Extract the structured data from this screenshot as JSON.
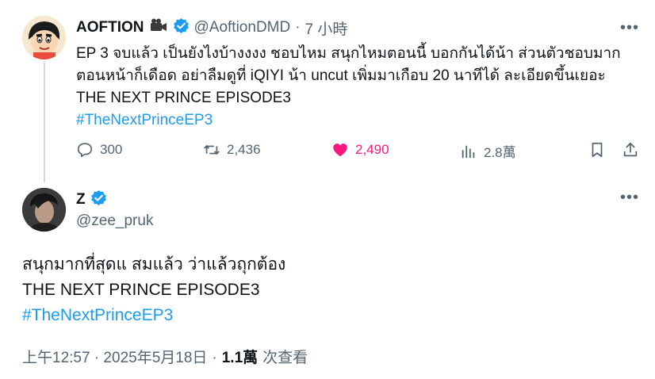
{
  "tweet": {
    "author_name": "AOFTION",
    "author_handle": "@AoftionDMD",
    "separator": "·",
    "time": "7 小時",
    "lines": [
      "EP 3 จบแล้ว เป็นยังไงบ้างงงง ชอบไหม สนุกไหมตอนนี้ บอกกันได้น้า ส่วนตัวชอบมาก",
      "ตอนหน้าก็เดือด อย่าลืมดูที่ iQIYI น้า uncut เพิ่มมาเกือบ 20 นาทีได้ ละเอียดขึ้นเยอะ",
      "THE NEXT PRINCE EPISODE3"
    ],
    "hashtag": "#TheNextPrinceEP3",
    "replies": "300",
    "retweets": "2,436",
    "likes": "2,490",
    "views": "2.8萬",
    "like_color": "#f91880",
    "verified_color": "#1d9bf0"
  },
  "reply": {
    "author_name": "Z",
    "author_handle": "@zee_pruk",
    "lines": [
      "สนุกมากที่สุดแ สมแล้ว ว่าแล้วถุกต้อง",
      "THE NEXT PRINCE EPISODE3"
    ],
    "hashtag": "#TheNextPrinceEP3",
    "timestamp": "上午12:57 · 2025年5月18日",
    "dot": "·",
    "views_count": "1.1萬",
    "views_label": "次查看"
  },
  "icons": {
    "more": "more-icon",
    "reply": "reply-icon",
    "retweet": "retweet-icon",
    "like": "heart-icon",
    "views": "views-icon",
    "bookmark": "bookmark-icon",
    "share": "share-icon",
    "verified": "verified-badge-icon",
    "camera": "movie-camera-icon"
  }
}
